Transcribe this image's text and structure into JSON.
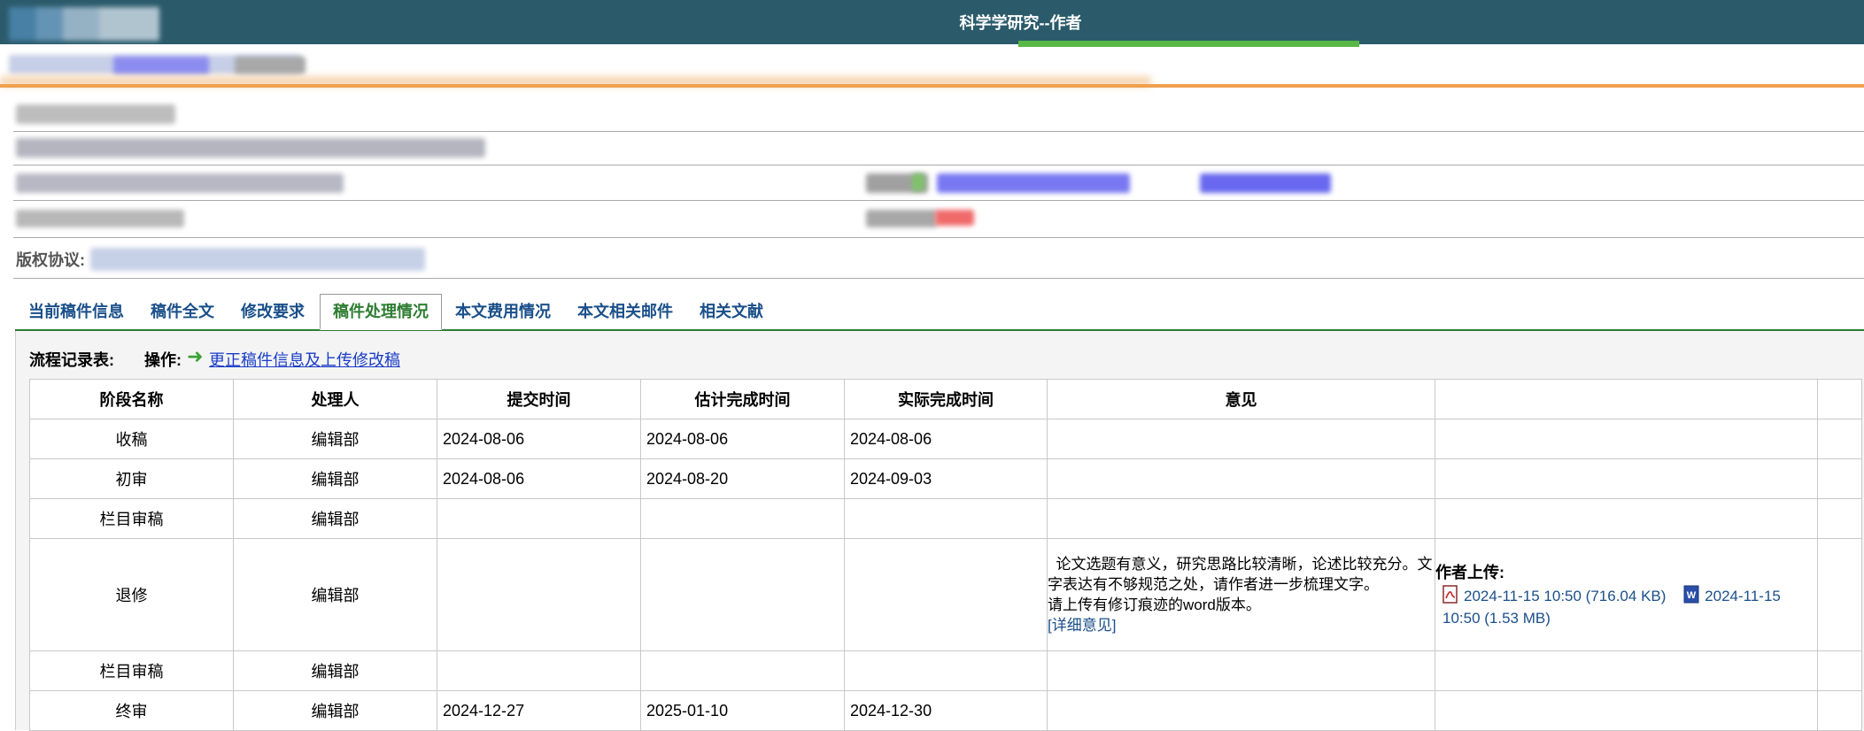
{
  "header": {
    "title": "科学学研究--作者"
  },
  "manuscript_info": {
    "copyright_label": "版权协议:"
  },
  "tabs": [
    {
      "label": "当前稿件信息",
      "active": false
    },
    {
      "label": "稿件全文",
      "active": false
    },
    {
      "label": "修改要求",
      "active": false
    },
    {
      "label": "稿件处理情况",
      "active": true
    },
    {
      "label": "本文费用情况",
      "active": false
    },
    {
      "label": "本文相关邮件",
      "active": false
    },
    {
      "label": "相关文献",
      "active": false
    }
  ],
  "flow": {
    "label": "流程记录表:",
    "operation_label": "操作:",
    "operation_link": "更正稿件信息及上传修改稿",
    "columns": [
      "阶段名称",
      "处理人",
      "提交时间",
      "估计完成时间",
      "实际完成时间",
      "意见"
    ],
    "rows": [
      {
        "stage": "收稿",
        "handler": "编辑部",
        "submit": "2024-08-06",
        "estimate": "2024-08-06",
        "actual": "2024-08-06"
      },
      {
        "stage": "初审",
        "handler": "编辑部",
        "submit": "2024-08-06",
        "estimate": "2024-08-20",
        "actual": "2024-09-03"
      },
      {
        "stage": "栏目审稿",
        "handler": "编辑部",
        "submit": "",
        "estimate": "",
        "actual": ""
      },
      {
        "stage": "退修",
        "handler": "编辑部",
        "submit": "",
        "estimate": "",
        "actual": ""
      },
      {
        "stage": "栏目审稿",
        "handler": "编辑部",
        "submit": "",
        "estimate": "",
        "actual": ""
      },
      {
        "stage": "终审",
        "handler": "编辑部",
        "submit": "2024-12-27",
        "estimate": "2025-01-10",
        "actual": "2024-12-30"
      }
    ],
    "revision": {
      "opinion_line1": "  论文选题有意义，研究思路比较清晰，论述比较充分。文字表达有不够规范之处，请作者进一步梳理文字。",
      "opinion_line2": "请上传有修订痕迹的word版本。",
      "detail_link": "[详细意见]",
      "upload_title": "作者上传:",
      "file_pdf": "2024-11-15 10:50 (716.04 KB)",
      "file_word": "2024-11-15 10:50 (1.53 MB)",
      "pdf_icon": "pdf-icon",
      "word_icon": "word-icon"
    }
  }
}
